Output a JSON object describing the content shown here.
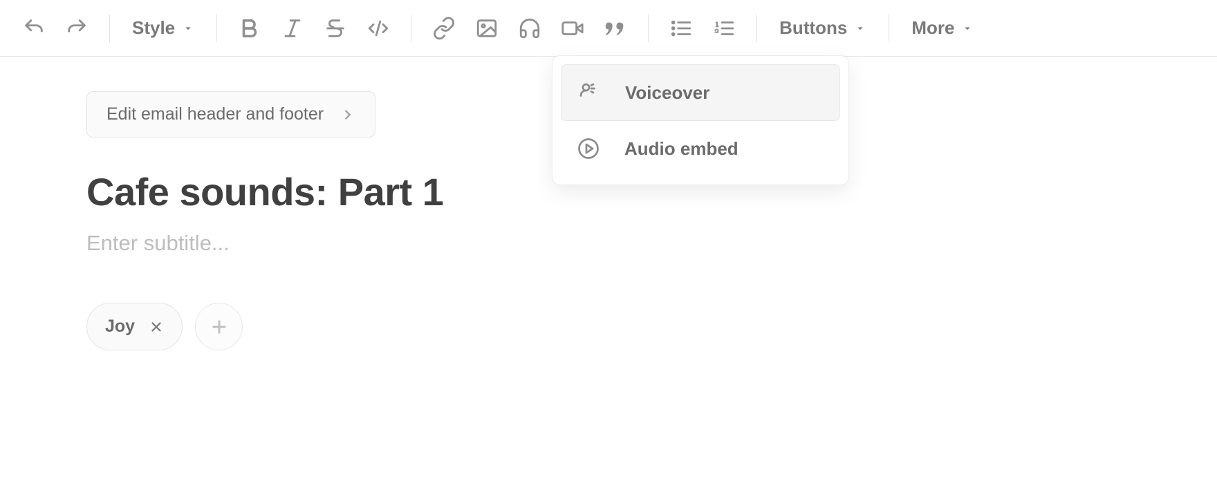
{
  "toolbar": {
    "style_label": "Style",
    "buttons_label": "Buttons",
    "more_label": "More"
  },
  "header_footer_button": "Edit email header and footer",
  "title": "Cafe sounds: Part 1",
  "subtitle_placeholder": "Enter subtitle...",
  "tags": [
    "Joy"
  ],
  "dropdown": {
    "items": [
      {
        "label": "Voiceover"
      },
      {
        "label": "Audio embed"
      }
    ]
  }
}
